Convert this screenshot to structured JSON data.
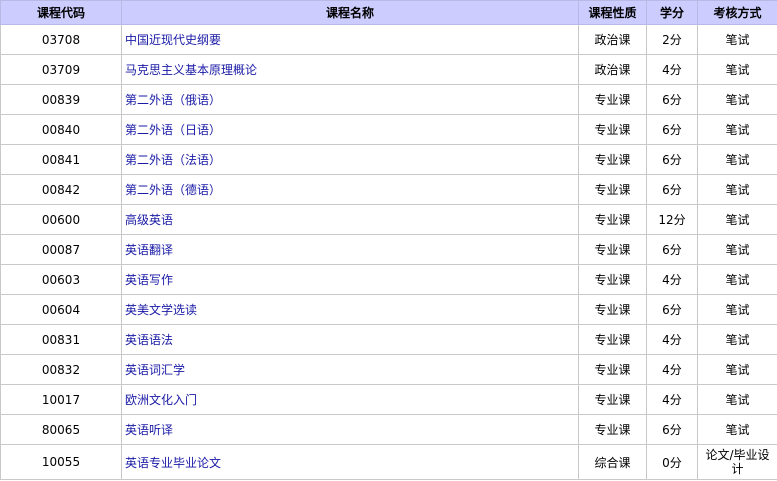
{
  "table": {
    "headers": {
      "code": "课程代码",
      "name": "课程名称",
      "type": "课程性质",
      "credits": "学分",
      "exam": "考核方式"
    },
    "rows": [
      {
        "code": "03708",
        "name": "中国近现代史纲要",
        "type": "政治课",
        "credits": "2分",
        "exam": "笔试"
      },
      {
        "code": "03709",
        "name": "马克思主义基本原理概论",
        "type": "政治课",
        "credits": "4分",
        "exam": "笔试"
      },
      {
        "code": "00839",
        "name": "第二外语（俄语）",
        "type": "专业课",
        "credits": "6分",
        "exam": "笔试"
      },
      {
        "code": "00840",
        "name": "第二外语（日语）",
        "type": "专业课",
        "credits": "6分",
        "exam": "笔试"
      },
      {
        "code": "00841",
        "name": "第二外语（法语）",
        "type": "专业课",
        "credits": "6分",
        "exam": "笔试"
      },
      {
        "code": "00842",
        "name": "第二外语（德语）",
        "type": "专业课",
        "credits": "6分",
        "exam": "笔试"
      },
      {
        "code": "00600",
        "name": "高级英语",
        "type": "专业课",
        "credits": "12分",
        "exam": "笔试"
      },
      {
        "code": "00087",
        "name": "英语翻译",
        "type": "专业课",
        "credits": "6分",
        "exam": "笔试"
      },
      {
        "code": "00603",
        "name": "英语写作",
        "type": "专业课",
        "credits": "4分",
        "exam": "笔试"
      },
      {
        "code": "00604",
        "name": "英美文学选读",
        "type": "专业课",
        "credits": "6分",
        "exam": "笔试"
      },
      {
        "code": "00831",
        "name": "英语语法",
        "type": "专业课",
        "credits": "4分",
        "exam": "笔试"
      },
      {
        "code": "00832",
        "name": "英语词汇学",
        "type": "专业课",
        "credits": "4分",
        "exam": "笔试"
      },
      {
        "code": "10017",
        "name": "欧洲文化入门",
        "type": "专业课",
        "credits": "4分",
        "exam": "笔试"
      },
      {
        "code": "80065",
        "name": "英语听译",
        "type": "专业课",
        "credits": "6分",
        "exam": "笔试"
      },
      {
        "code": "10055",
        "name": "英语专业毕业论文",
        "type": "综合课",
        "credits": "0分",
        "exam": "论文/毕业设计"
      }
    ]
  },
  "colors": {
    "header_bg": "#ccccff",
    "link": "#1a1aa6",
    "border": "#c9c9c9"
  }
}
